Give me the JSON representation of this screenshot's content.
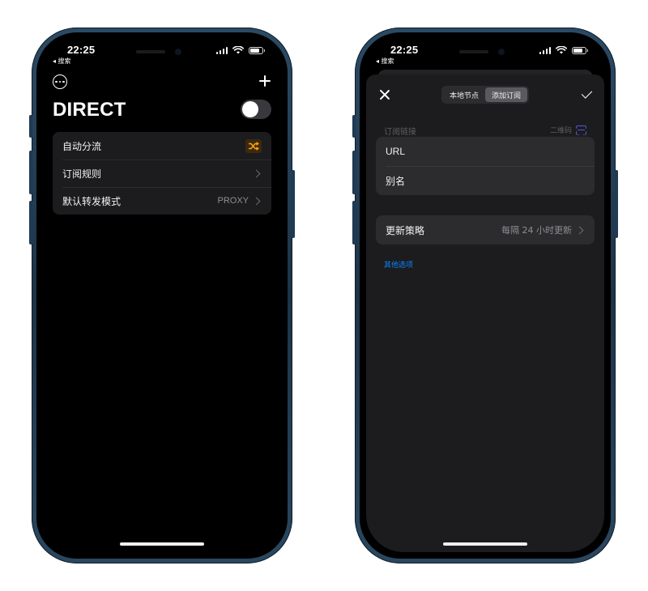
{
  "status_bar": {
    "time": "22:25",
    "back_label": "◂ 搜索"
  },
  "left": {
    "title": "DIRECT",
    "rows": [
      {
        "label": "自动分流",
        "value": "",
        "accessory": "shuffle-icon"
      },
      {
        "label": "订阅规则",
        "value": "",
        "accessory": "chevron"
      },
      {
        "label": "默认转发模式",
        "value": "PROXY",
        "accessory": "chevron"
      }
    ],
    "toggle_on": false
  },
  "right": {
    "segments": [
      "本地节点",
      "添加订阅"
    ],
    "active_segment": "添加订阅",
    "section_label": "订阅链接",
    "qr_label": "二维码",
    "fields": [
      {
        "label": "URL"
      },
      {
        "label": "别名"
      }
    ],
    "update": {
      "label": "更新策略",
      "value": "每隔 24 小时更新"
    },
    "more_options": "其他选项"
  },
  "colors": {
    "accent": "#ff9f0a",
    "link": "#0a84ff",
    "qr": "#5856d6",
    "frame": "#1d3447"
  }
}
